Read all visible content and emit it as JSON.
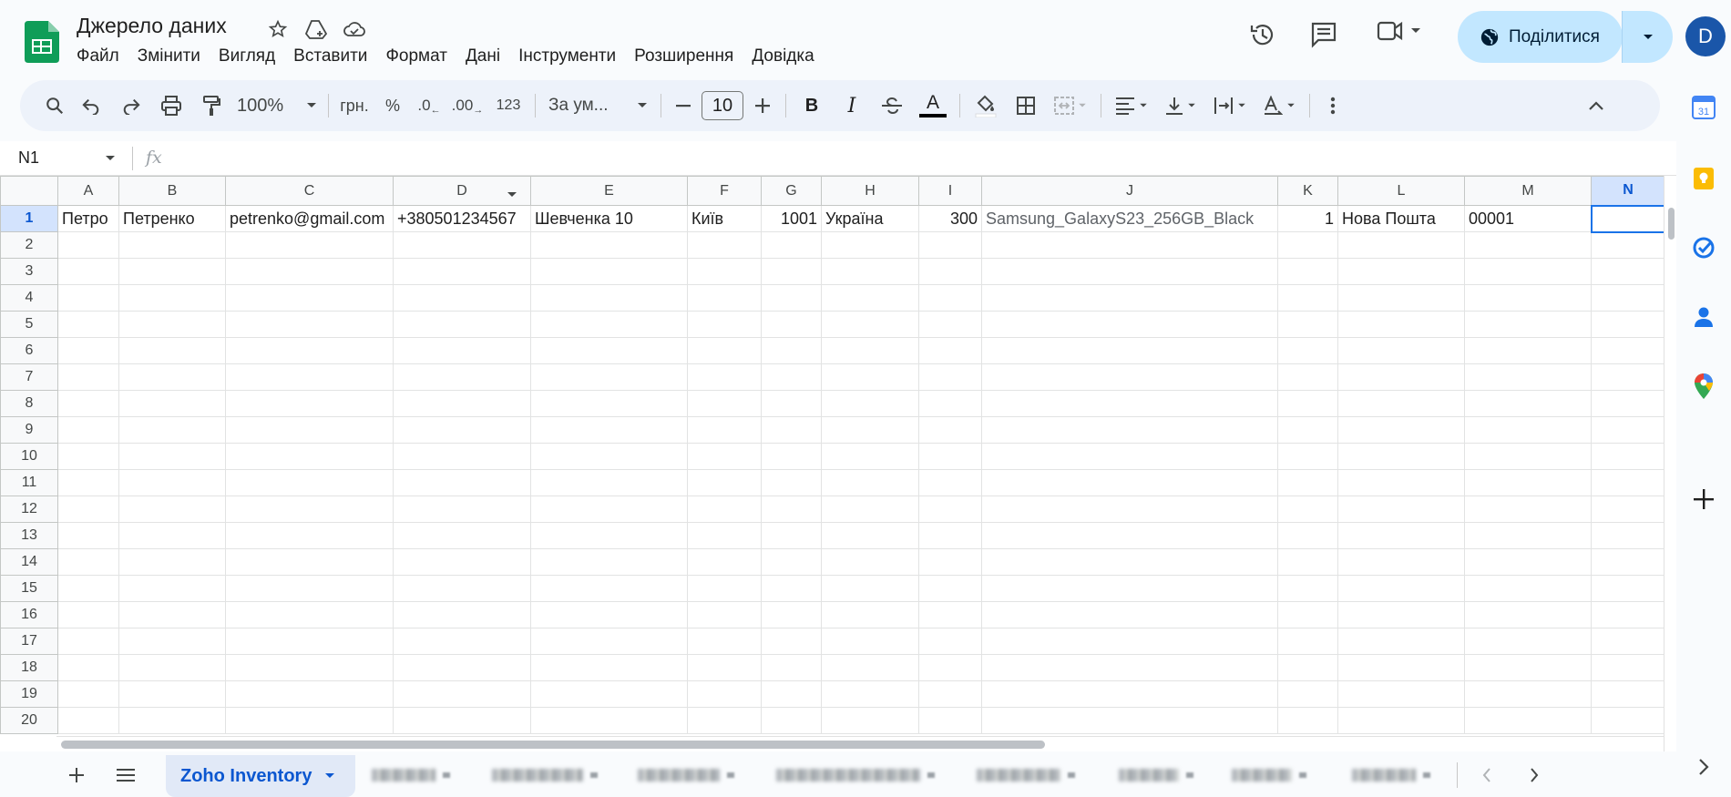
{
  "doc": {
    "title": "Джерело даних"
  },
  "menu": [
    "Файл",
    "Змінити",
    "Вигляд",
    "Вставити",
    "Формат",
    "Дані",
    "Інструменти",
    "Розширення",
    "Довідка"
  ],
  "header": {
    "share_label": "Поділитися",
    "avatar_letter": "D"
  },
  "toolbar": {
    "zoom": "100%",
    "currency": "грн.",
    "percent": "%",
    "dec_decrease": ".0",
    "dec_increase": ".00",
    "number_format": "123",
    "font": "За ум...",
    "font_size": "10",
    "bold": "B",
    "italic": "I",
    "text_color_letter": "A"
  },
  "formula_bar": {
    "cell_ref": "N1",
    "fx": "fx",
    "content": ""
  },
  "grid": {
    "columns": [
      "A",
      "B",
      "C",
      "D",
      "E",
      "F",
      "G",
      "H",
      "I",
      "J",
      "K",
      "L",
      "M",
      "N"
    ],
    "row_numbers": [
      "1",
      "2",
      "3",
      "4",
      "5",
      "6",
      "7",
      "8",
      "9",
      "10",
      "11",
      "12",
      "13",
      "14",
      "15",
      "16",
      "17",
      "18",
      "19",
      "20"
    ],
    "row1": [
      "Петро",
      "Петренко",
      "petrenko@gmail.com",
      "+380501234567",
      "Шевченка 10",
      "Київ",
      "1001",
      "Україна",
      "300",
      "Samsung_GalaxyS23_256GB_Black",
      "1",
      "Нова Пошта",
      "00001",
      ""
    ]
  },
  "sheets": {
    "active": "Zoho Inventory"
  },
  "colors": {
    "accent": "#0b57d0",
    "share_bg": "#c2e7ff",
    "sheets_green": "#0f9d58"
  }
}
